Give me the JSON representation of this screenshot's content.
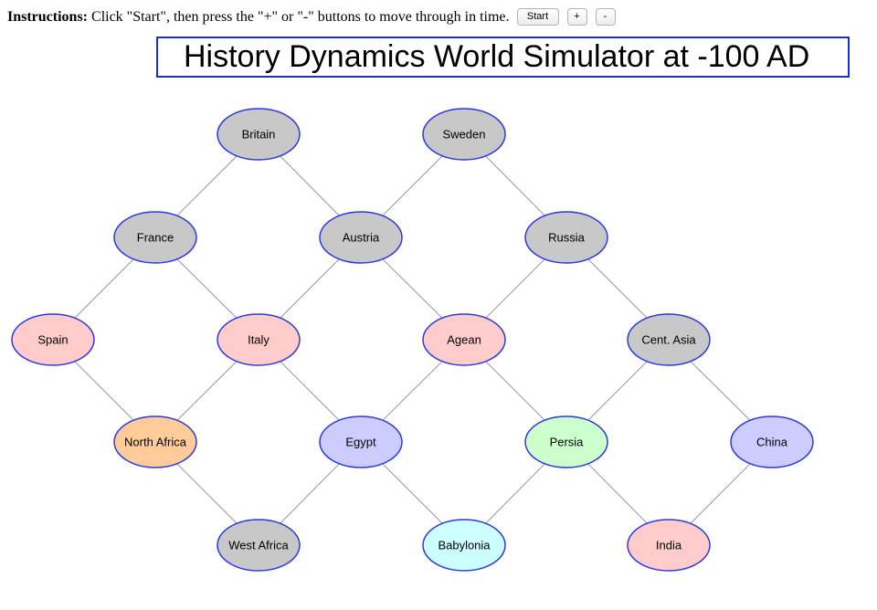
{
  "instructions": {
    "prefix": "Instructions:",
    "text": "Click \"Start\", then press the \"+\" or \"-\" buttons to move through in time.",
    "start_label": "Start",
    "plus_label": "+",
    "minus_label": "-"
  },
  "title": "History Dynamics World Simulator at -100 AD",
  "colors": {
    "gray": "#c8c8c8",
    "pink": "#ffcccc",
    "orange": "#ffcc99",
    "blue": "#ccccff",
    "green": "#ccffcc",
    "cyan": "#ccffff",
    "border": "#2c3ae0",
    "edge": "#9a9a9a"
  },
  "nodes": [
    {
      "id": "britain",
      "label": "Britain",
      "color": "gray"
    },
    {
      "id": "sweden",
      "label": "Sweden",
      "color": "gray"
    },
    {
      "id": "france",
      "label": "France",
      "color": "gray"
    },
    {
      "id": "austria",
      "label": "Austria",
      "color": "gray"
    },
    {
      "id": "russia",
      "label": "Russia",
      "color": "gray"
    },
    {
      "id": "spain",
      "label": "Spain",
      "color": "pink"
    },
    {
      "id": "italy",
      "label": "Italy",
      "color": "pink"
    },
    {
      "id": "agean",
      "label": "Agean",
      "color": "pink"
    },
    {
      "id": "central-asia",
      "label": "Cent. Asia",
      "color": "gray"
    },
    {
      "id": "north-africa",
      "label": "North Africa",
      "color": "orange"
    },
    {
      "id": "egypt",
      "label": "Egypt",
      "color": "blue"
    },
    {
      "id": "persia",
      "label": "Persia",
      "color": "green"
    },
    {
      "id": "china",
      "label": "China",
      "color": "blue"
    },
    {
      "id": "west-africa",
      "label": "West Africa",
      "color": "gray"
    },
    {
      "id": "babylonia",
      "label": "Babylonia",
      "color": "cyan"
    },
    {
      "id": "india",
      "label": "India",
      "color": "pink"
    }
  ],
  "edges": [
    [
      "britain",
      "france"
    ],
    [
      "britain",
      "austria"
    ],
    [
      "sweden",
      "austria"
    ],
    [
      "sweden",
      "russia"
    ],
    [
      "france",
      "spain"
    ],
    [
      "france",
      "italy"
    ],
    [
      "austria",
      "italy"
    ],
    [
      "austria",
      "agean"
    ],
    [
      "russia",
      "agean"
    ],
    [
      "russia",
      "central-asia"
    ],
    [
      "spain",
      "north-africa"
    ],
    [
      "italy",
      "north-africa"
    ],
    [
      "italy",
      "egypt"
    ],
    [
      "agean",
      "egypt"
    ],
    [
      "agean",
      "persia"
    ],
    [
      "central-asia",
      "persia"
    ],
    [
      "central-asia",
      "china"
    ],
    [
      "north-africa",
      "west-africa"
    ],
    [
      "egypt",
      "west-africa"
    ],
    [
      "egypt",
      "babylonia"
    ],
    [
      "persia",
      "babylonia"
    ],
    [
      "persia",
      "india"
    ],
    [
      "china",
      "india"
    ]
  ]
}
